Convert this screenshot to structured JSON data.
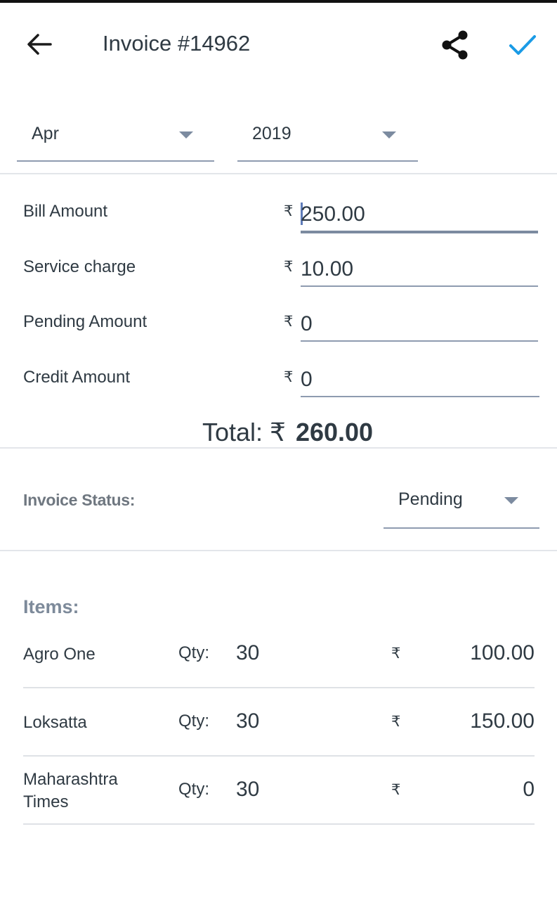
{
  "header": {
    "title": "Invoice #14962"
  },
  "period": {
    "month": "Apr",
    "year": "2019"
  },
  "currency_symbol": "₹",
  "amounts": [
    {
      "label": "Bill Amount",
      "value": "250.00"
    },
    {
      "label": "Service charge",
      "value": "10.00"
    },
    {
      "label": "Pending Amount",
      "value": "0"
    },
    {
      "label": "Credit Amount",
      "value": "0"
    }
  ],
  "total": {
    "label": "Total: ₹",
    "value": "260.00"
  },
  "status": {
    "label": "Invoice Status:",
    "value": "Pending"
  },
  "items_section": {
    "title": "Items:",
    "qty_label": "Qty:",
    "items": [
      {
        "name": "Agro One",
        "qty": "30",
        "price": "100.00"
      },
      {
        "name": "Loksatta",
        "qty": "30",
        "price": "150.00"
      },
      {
        "name": "Maharashtra Times",
        "qty": "30",
        "price": "0"
      }
    ]
  },
  "colors": {
    "accent": "#1a9be6",
    "text": "#2f3a43",
    "underline": "#8e9bb0",
    "muted_label": "#7d8a9a"
  },
  "icons": {
    "back": "arrow-left-icon",
    "share": "share-icon",
    "save": "check-icon",
    "dropdown": "caret-down-icon"
  }
}
